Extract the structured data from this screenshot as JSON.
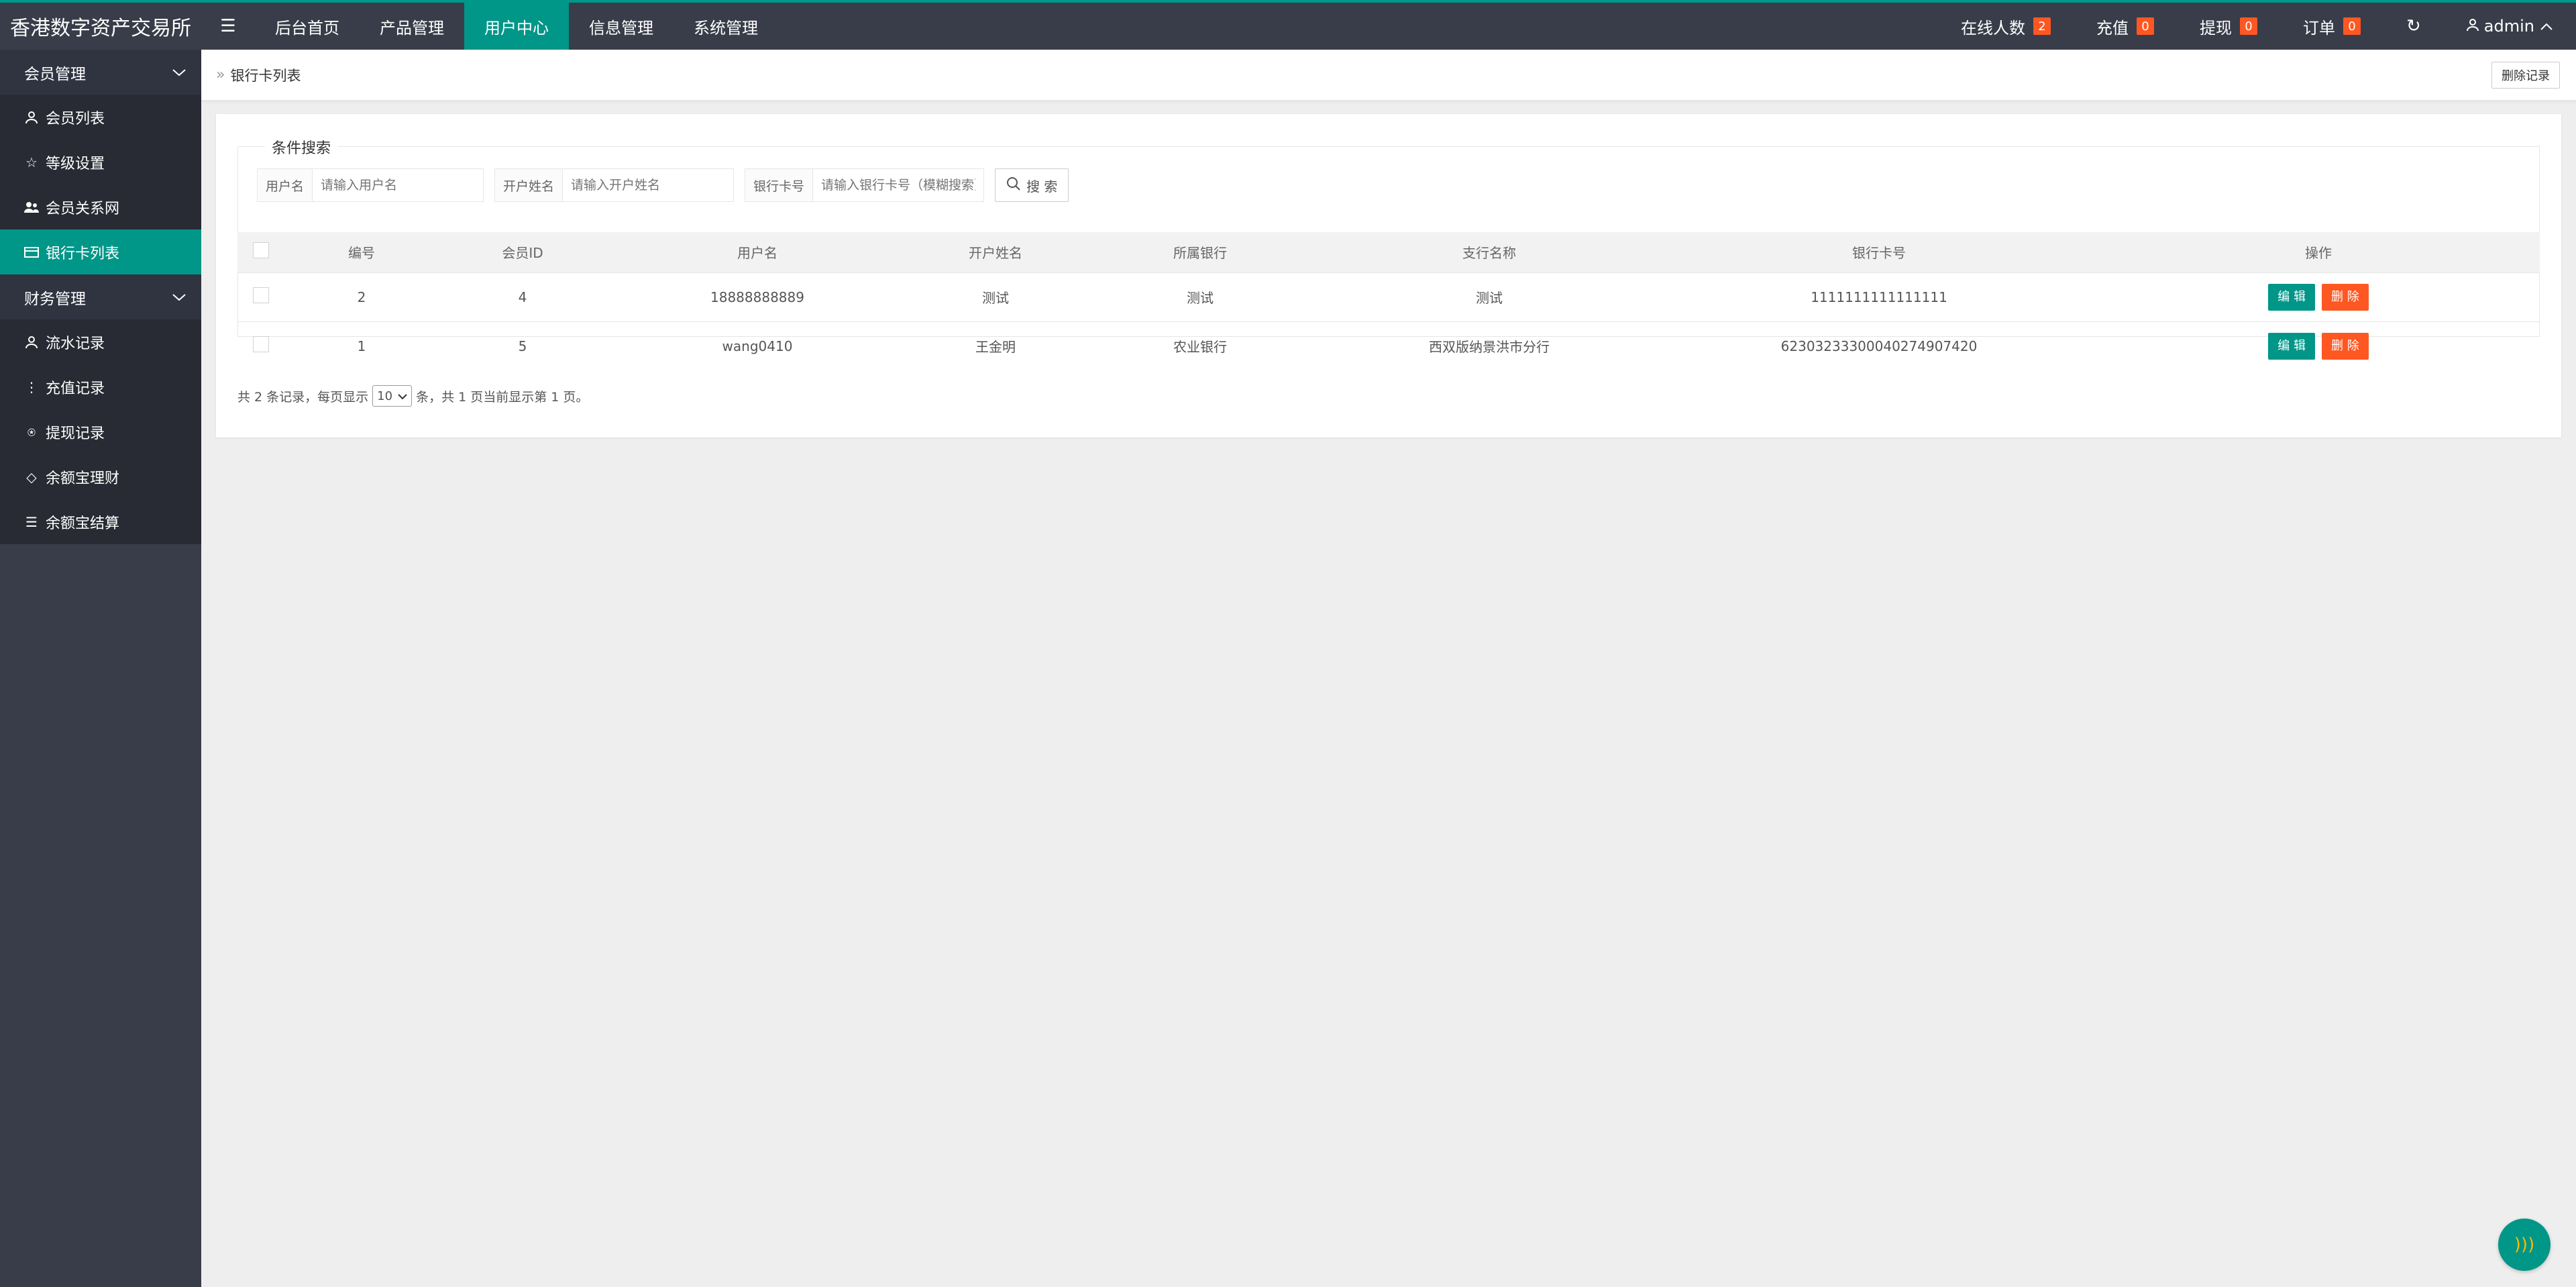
{
  "header": {
    "logo": "香港数字资产交易所",
    "nav": [
      {
        "label": "后台首页"
      },
      {
        "label": "产品管理"
      },
      {
        "label": "用户中心"
      },
      {
        "label": "信息管理"
      },
      {
        "label": "系统管理"
      }
    ],
    "stats": [
      {
        "label": "在线人数",
        "count": "2"
      },
      {
        "label": "充值",
        "count": "0"
      },
      {
        "label": "提现",
        "count": "0"
      },
      {
        "label": "订单",
        "count": "0"
      }
    ],
    "user": "admin"
  },
  "sidebar": {
    "groups": [
      {
        "title": "会员管理",
        "items": [
          {
            "label": "会员列表",
            "icon": "user-icon"
          },
          {
            "label": "等级设置",
            "icon": "star-icon"
          },
          {
            "label": "会员关系网",
            "icon": "users-icon"
          },
          {
            "label": "银行卡列表",
            "icon": "card-icon",
            "active": true
          }
        ]
      },
      {
        "title": "财务管理",
        "items": [
          {
            "label": "流水记录",
            "icon": "user-icon"
          },
          {
            "label": "充值记录",
            "icon": "more-icon"
          },
          {
            "label": "提现记录",
            "icon": "coin-icon"
          },
          {
            "label": "余额宝理财",
            "icon": "diamond-icon"
          },
          {
            "label": "余额宝结算",
            "icon": "list-icon"
          }
        ]
      }
    ]
  },
  "breadcrumb": {
    "current": "银行卡列表",
    "action": "删除记录"
  },
  "search": {
    "legend": "条件搜索",
    "fields": [
      {
        "label": "用户名",
        "placeholder": "请输入用户名"
      },
      {
        "label": "开户姓名",
        "placeholder": "请输入开户姓名"
      },
      {
        "label": "银行卡号",
        "placeholder": "请输入银行卡号（模糊搜索）"
      }
    ],
    "button": "搜 索"
  },
  "table": {
    "headers": [
      "编号",
      "会员ID",
      "用户名",
      "开户姓名",
      "所属银行",
      "支行名称",
      "银行卡号",
      "操作"
    ],
    "rows": [
      {
        "id": "2",
        "member_id": "4",
        "username": "18888888889",
        "name": "测试",
        "bank": "测试",
        "branch": "测试",
        "card": "1111111111111111"
      },
      {
        "id": "1",
        "member_id": "5",
        "username": "wang0410",
        "name": "王金明",
        "bank": "农业银行",
        "branch": "西双版纳景洪市分行",
        "card": "6230323330004027490742​0"
      }
    ],
    "edit_label": "编 辑",
    "delete_label": "删 除"
  },
  "pager": {
    "prefix": "共 2 条记录，每页显示",
    "page_size": "10",
    "suffix": "条，共 1 页当前显示第 1 页。"
  },
  "colors": {
    "accent": "#009688",
    "danger": "#ff5722",
    "header": "#393d49"
  }
}
